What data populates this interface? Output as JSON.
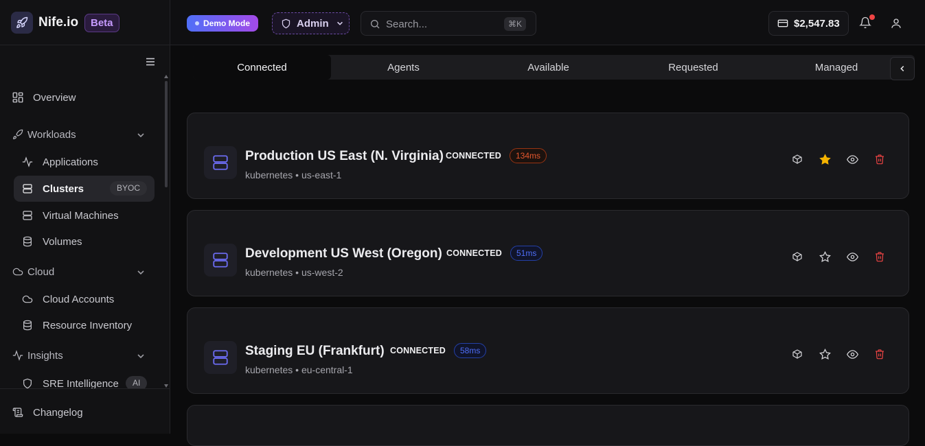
{
  "brand": {
    "name": "Nife.io",
    "badge": "Beta"
  },
  "topbar": {
    "demo_mode": "Demo Mode",
    "role": "Admin",
    "search_placeholder": "Search...",
    "search_shortcut": "⌘K",
    "balance": "$2,547.83"
  },
  "sidebar": {
    "overview": "Overview",
    "workloads": "Workloads",
    "applications": "Applications",
    "clusters": "Clusters",
    "clusters_badge": "BYOC",
    "virtual_machines": "Virtual Machines",
    "volumes": "Volumes",
    "cloud": "Cloud",
    "cloud_accounts": "Cloud Accounts",
    "resource_inventory": "Resource Inventory",
    "insights": "Insights",
    "sre_intelligence": "SRE Intelligence",
    "sre_badge": "AI",
    "changelog": "Changelog"
  },
  "tabs": [
    "Connected",
    "Agents",
    "Available",
    "Requested",
    "Managed"
  ],
  "clusters": [
    {
      "name": "Production US East (N. Virginia)",
      "status": "CONNECTED",
      "latency": "134ms",
      "latency_color": "#e4572e",
      "type": "kubernetes",
      "region": "us-east-1",
      "favorite": true
    },
    {
      "name": "Development US West (Oregon)",
      "status": "CONNECTED",
      "latency": "51ms",
      "latency_color": "#4f6ef7",
      "type": "kubernetes",
      "region": "us-west-2",
      "favorite": false
    },
    {
      "name": "Staging EU (Frankfurt)",
      "status": "CONNECTED",
      "latency": "58ms",
      "latency_color": "#4f6ef7",
      "type": "kubernetes",
      "region": "eu-central-1",
      "favorite": false
    }
  ],
  "colors": {
    "accent": "#5b5bd6",
    "star": "#f5b301",
    "danger": "#ef4444"
  }
}
